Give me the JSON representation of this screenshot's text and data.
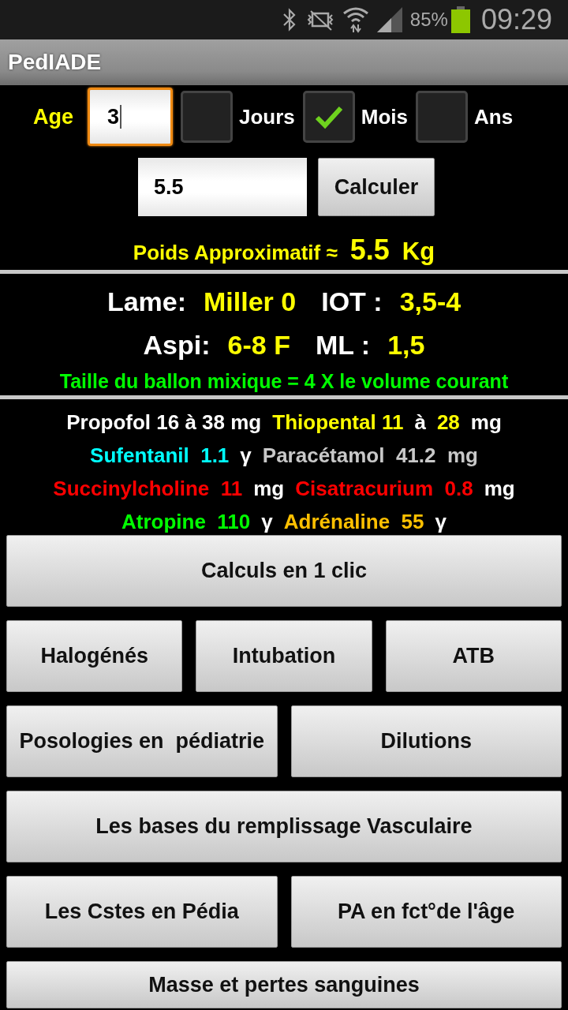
{
  "status_bar": {
    "battery": "85%",
    "time": "09:29"
  },
  "app_bar": {
    "title": "PedIADE"
  },
  "age": {
    "label": "Age",
    "value": "3",
    "focused": true,
    "units": [
      {
        "label": "Jours",
        "checked": false
      },
      {
        "label": "Mois",
        "checked": true
      },
      {
        "label": "Ans",
        "checked": false
      }
    ]
  },
  "weight": {
    "value": "5.5",
    "button": "Calculer"
  },
  "weight_result": {
    "label": "Poids Approximatif ≈",
    "value": "5.5",
    "unit": "Kg"
  },
  "airway": {
    "rows": [
      [
        {
          "text": "Lame:",
          "color": "#ffffff"
        },
        {
          "text": "Miller 0",
          "color": "#ffff00"
        },
        {
          "text": "IOT :",
          "color": "#ffffff"
        },
        {
          "text": "3,5-4",
          "color": "#ffff00"
        }
      ],
      [
        {
          "text": "Aspi:",
          "color": "#ffffff"
        },
        {
          "text": "6-8 F",
          "color": "#ffff00"
        },
        {
          "text": "ML :",
          "color": "#ffffff"
        },
        {
          "text": "1,5",
          "color": "#ffff00"
        }
      ]
    ],
    "note": "Taille du ballon mixique = 4 X le volume courant"
  },
  "drugs": [
    [
      {
        "text": "Propofol 16 à 38 mg",
        "color": "#ffffff"
      },
      {
        "text": "Thiopental 11",
        "color": "#ffff00"
      },
      {
        "text": "à",
        "color": "#ffffff"
      },
      {
        "text": "28",
        "color": "#ffff00"
      },
      {
        "text": "mg",
        "color": "#ffffff"
      }
    ],
    [
      {
        "text": "Sufentanil  1.1",
        "color": "#00ffff"
      },
      {
        "text": "γ",
        "color": "#ffffff"
      },
      {
        "text": "Paracétamol  41.2  mg",
        "color": "#c8c8c8"
      }
    ],
    [
      {
        "text": "Succinylcholine  11",
        "color": "#ff0000"
      },
      {
        "text": "mg",
        "color": "#ffffff"
      },
      {
        "text": "Cisatracurium  0.8",
        "color": "#ff0000"
      },
      {
        "text": "mg",
        "color": "#ffffff"
      }
    ],
    [
      {
        "text": "Atropine  110",
        "color": "#00ff00"
      },
      {
        "text": "γ",
        "color": "#ffffff"
      },
      {
        "text": "Adrénaline  55",
        "color": "#ffc000"
      },
      {
        "text": "γ",
        "color": "#ffffff"
      }
    ]
  ],
  "buttons": [
    [
      "Calculs en 1 clic"
    ],
    [
      "Halogénés",
      "Intubation",
      "ATB"
    ],
    [
      "Posologies en  pédiatrie",
      "Dilutions"
    ],
    [
      "Les bases du remplissage Vasculaire"
    ],
    [
      "Les Cstes en Pédia",
      "PA en fct°de l'âge"
    ],
    [
      "Masse et pertes sanguines"
    ]
  ]
}
